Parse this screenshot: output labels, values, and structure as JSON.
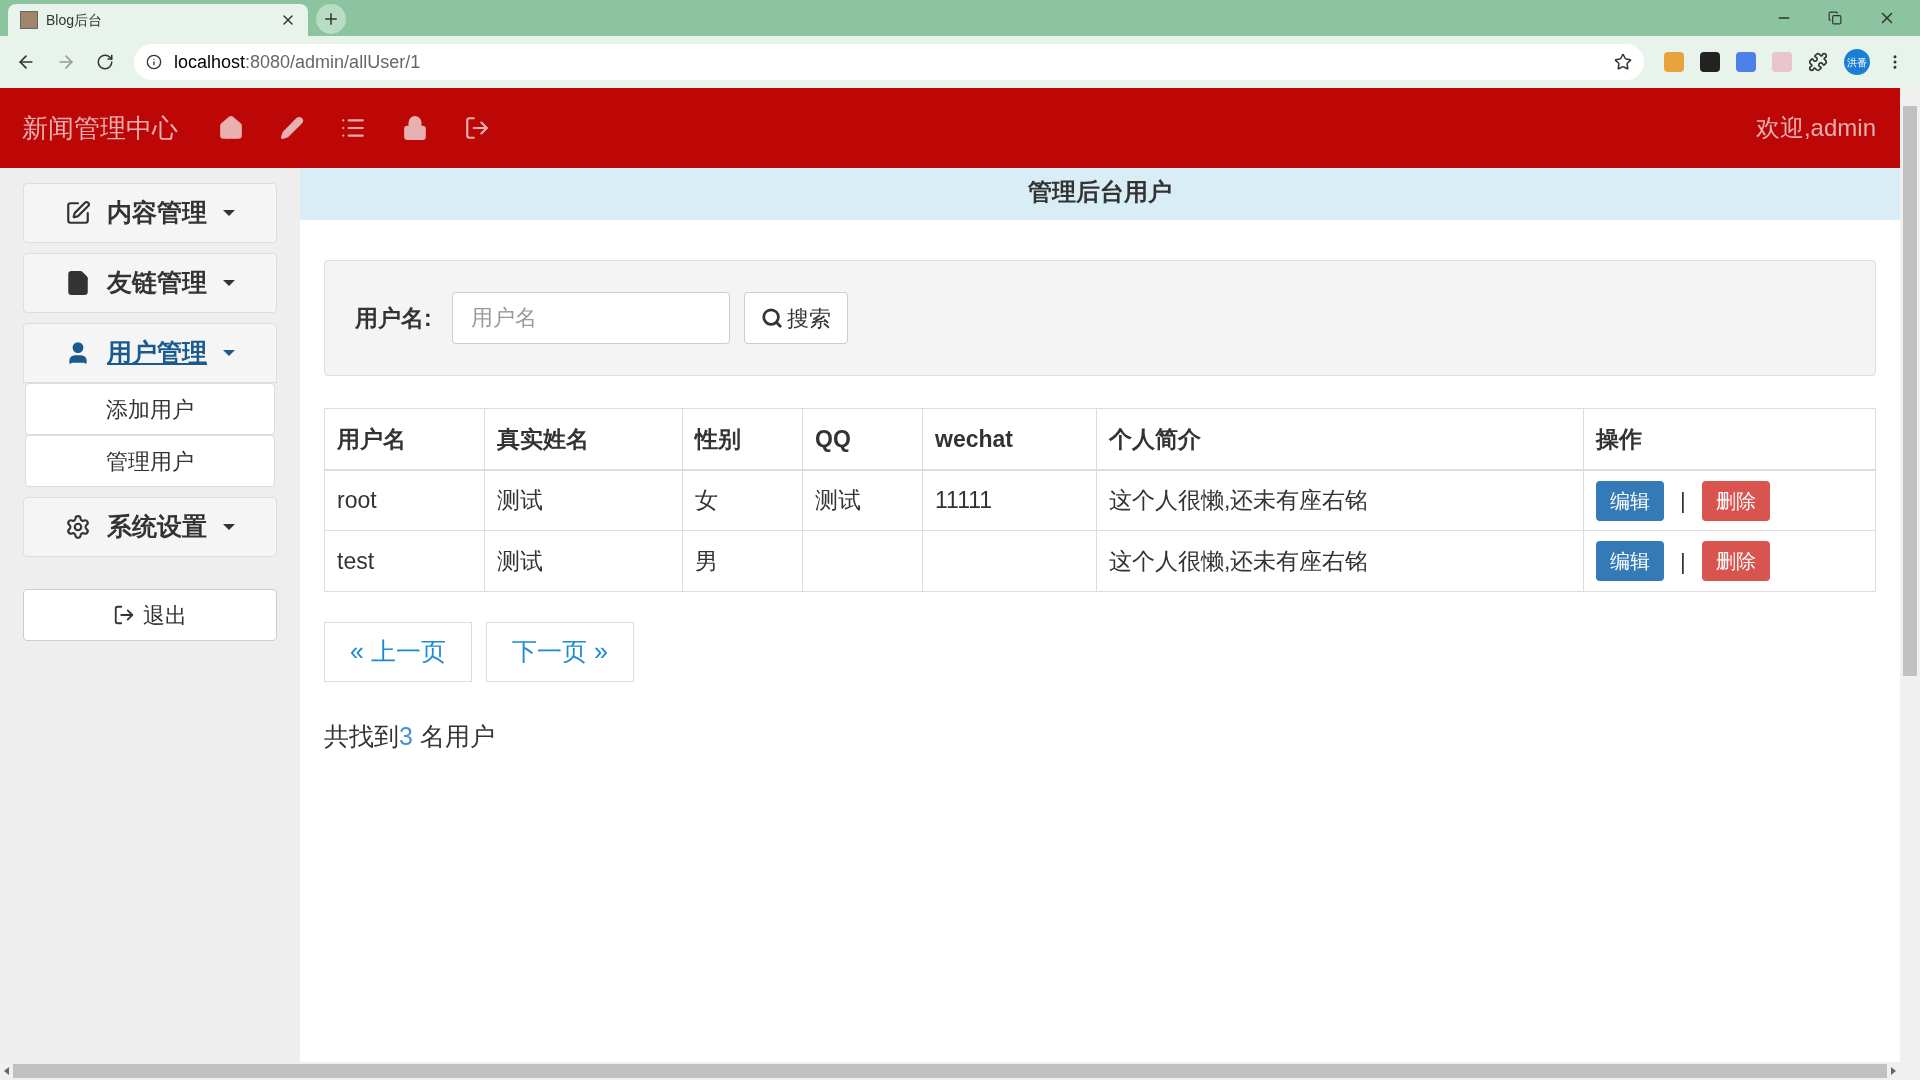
{
  "browser": {
    "tab_title": "Blog后台",
    "url_host": "localhost",
    "url_rest": ":8080/admin/allUser/1",
    "profile": "洪番"
  },
  "header": {
    "brand": "新闻管理中心",
    "greeting": "欢迎,admin"
  },
  "sidebar": {
    "menus": [
      {
        "label": "内容管理",
        "selected": false,
        "expanded": false
      },
      {
        "label": "友链管理",
        "selected": false,
        "expanded": false
      },
      {
        "label": "用户管理",
        "selected": true,
        "expanded": true,
        "children": [
          {
            "label": "添加用户"
          },
          {
            "label": "管理用户"
          }
        ]
      },
      {
        "label": "系统设置",
        "selected": false,
        "expanded": false
      }
    ],
    "logout": "退出"
  },
  "page_title": "管理后台用户",
  "search": {
    "label": "用户名:",
    "placeholder": "用户名",
    "button": "搜索"
  },
  "table": {
    "columns": [
      "用户名",
      "真实姓名",
      "性别",
      "QQ",
      "wechat",
      "个人简介",
      "操作"
    ],
    "rows": [
      {
        "cells": [
          "root",
          "测试",
          "女",
          "测试",
          "11111",
          "这个人很懒,还未有座右铭"
        ],
        "edit": "编辑",
        "separator": "|",
        "delete": "删除"
      },
      {
        "cells": [
          "test",
          "测试",
          "男",
          "",
          "",
          "这个人很懒,还未有座右铭"
        ],
        "edit": "编辑",
        "separator": "|",
        "delete": "删除"
      }
    ]
  },
  "pagination": {
    "prev": "« 上一页",
    "next": "下一页 »"
  },
  "summary": {
    "prefix": "共找到",
    "count": "3",
    "suffix": " 名用户"
  }
}
